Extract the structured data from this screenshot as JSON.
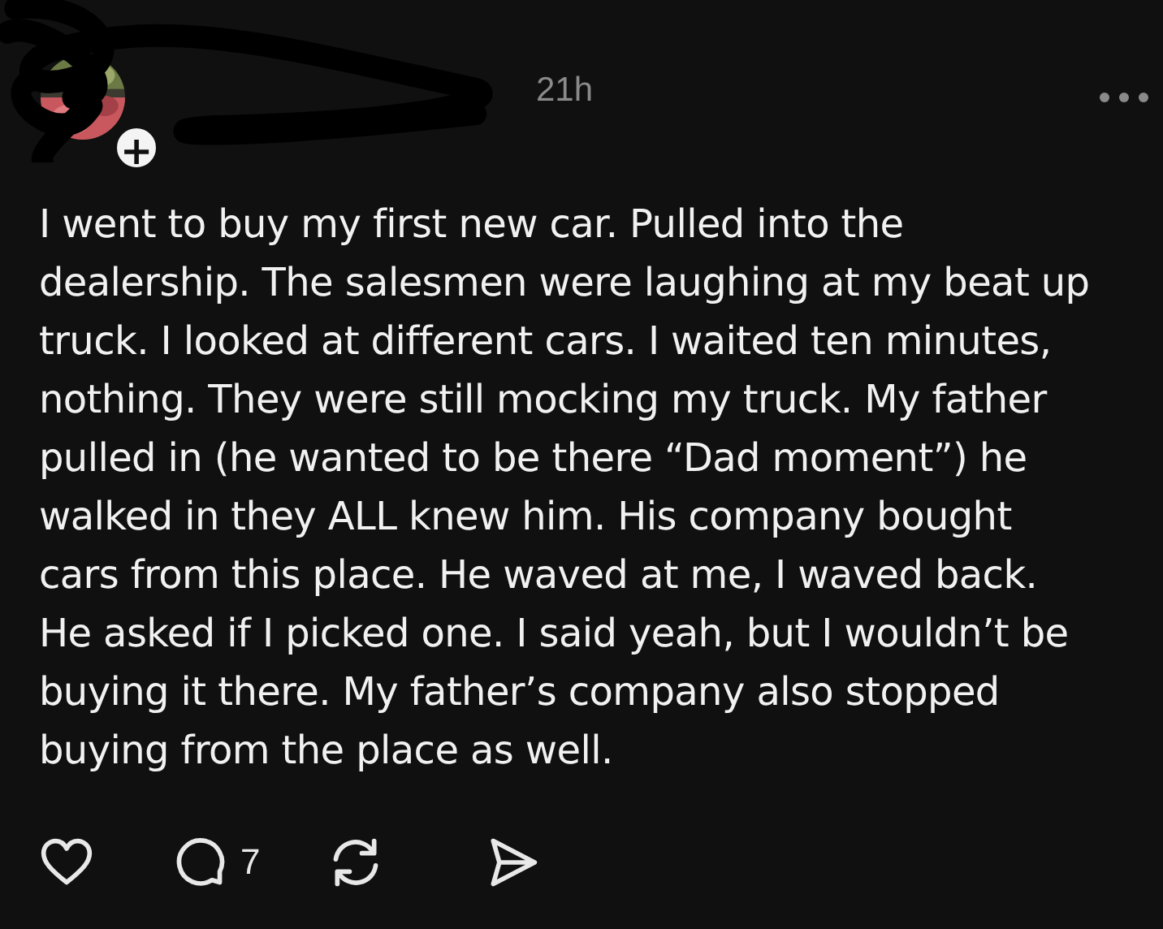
{
  "post": {
    "timestamp": "21h",
    "follow_badge": "+",
    "text": "I went to buy my first new car. Pulled into the dealership. The salesmen were laughing at my beat up truck. I looked at different cars. I waited ten minutes, nothing. They were still mocking my truck. My father pulled in (he wanted to be there “Dad moment”) he walked in they ALL knew him. His company bought cars from this place. He waved at me, I waved back. He asked if I picked one. I said yeah, but I wouldn’t be buying it there. My father’s company also stopped buying from the place as well.",
    "actions": [
      {
        "kind": "like"
      },
      {
        "kind": "reply",
        "count": "7"
      },
      {
        "kind": "repost"
      },
      {
        "kind": "share"
      }
    ]
  }
}
